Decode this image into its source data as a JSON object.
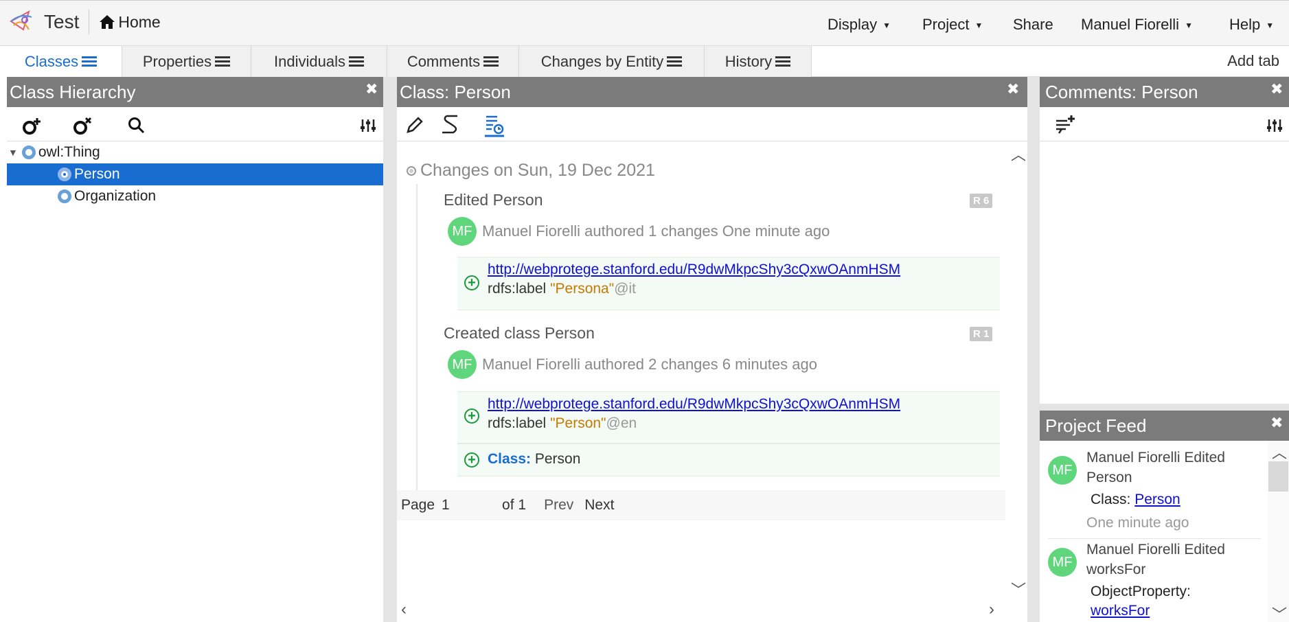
{
  "app": {
    "project_name": "Test",
    "home_label": "Home"
  },
  "menus": {
    "display": "Display",
    "project": "Project",
    "share": "Share",
    "user": "Manuel Fiorelli",
    "help": "Help"
  },
  "tabs": [
    {
      "label": "Classes",
      "active": true
    },
    {
      "label": "Properties",
      "active": false
    },
    {
      "label": "Individuals",
      "active": false
    },
    {
      "label": "Comments",
      "active": false
    },
    {
      "label": "Changes by Entity",
      "active": false
    },
    {
      "label": "History",
      "active": false
    }
  ],
  "add_tab_label": "Add tab",
  "class_hierarchy": {
    "title": "Class Hierarchy",
    "tree": [
      {
        "label": "owl:Thing",
        "expanded": true,
        "selected": false
      },
      {
        "label": "Person",
        "selected": true
      },
      {
        "label": "Organization",
        "selected": false
      }
    ]
  },
  "class_pane": {
    "title": "Class: Person",
    "changes_heading": "Changes on Sun, 19 Dec 2021",
    "entries": [
      {
        "title": "Edited Person",
        "revision": "R 6",
        "avatar": "MF",
        "author_text": "Manuel Fiorelli authored 1 changes One minute ago",
        "changes": [
          {
            "iri": "http://webprotege.stanford.edu/R9dwMkpcShy3cQxwOAnmHSM",
            "property": "rdfs:label",
            "literal": "\"Persona\"",
            "lang": "@it"
          }
        ]
      },
      {
        "title": "Created class Person",
        "revision": "R 1",
        "avatar": "MF",
        "author_text": "Manuel Fiorelli authored 2 changes 6 minutes ago",
        "changes": [
          {
            "iri": "http://webprotege.stanford.edu/R9dwMkpcShy3cQxwOAnmHSM",
            "property": "rdfs:label",
            "literal": "\"Person\"",
            "lang": "@en"
          },
          {
            "keyword": "Class:",
            "value": "Person"
          }
        ]
      }
    ],
    "pager": {
      "page_label": "Page",
      "page_value": "1",
      "of_label": "of 1",
      "prev": "Prev",
      "next": "Next"
    }
  },
  "comments_pane": {
    "title": "Comments: Person"
  },
  "project_feed": {
    "title": "Project Feed",
    "items": [
      {
        "avatar": "MF",
        "headline": "Manuel Fiorelli Edited Person",
        "kind": "Class:",
        "entity": "Person",
        "time": "One minute ago"
      },
      {
        "avatar": "MF",
        "headline": "Manuel Fiorelli Edited worksFor",
        "kind": "ObjectProperty:",
        "entity": "worksFor"
      }
    ]
  },
  "colors": {
    "accent": "#1a6dd0",
    "pane_header": "#7b7b7b",
    "avatar": "#5fd67b",
    "add_green": "#1a9a3a",
    "literal": "#c47a00"
  }
}
